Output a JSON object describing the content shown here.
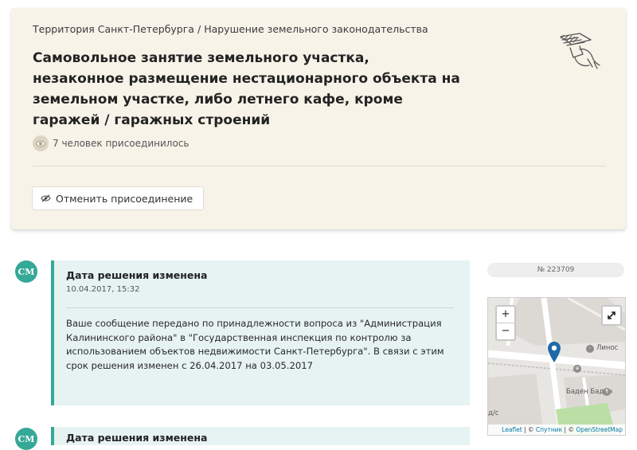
{
  "breadcrumb": {
    "region": "Территория Санкт-Петербурга",
    "separator": "/",
    "category": "Нарушение земельного законодательства"
  },
  "issue": {
    "title": "Самовольное занятие земельного участка, незаконное размещение нестационарного объекта на земельном участке, либо летнего кафе, кроме гаражей / гаражных строений",
    "joined_text": "7 человек присоединилось",
    "unjoin_label": "Отменить присоединение"
  },
  "events": [
    {
      "avatar": "СМ",
      "title": "Дата решения изменена",
      "time": "10.04.2017, 15:32",
      "body": "Ваше сообщение передано по принадлежности вопроса из \"Администрация Калининского района\" в \"Государственная инспекция по контролю за использованием объектов недвижимости Санкт-Петербурга\". В связи с этим срок решения изменен с 26.04.2017 на 03.05.2017"
    },
    {
      "avatar": "СМ",
      "title": "Дата решения изменена"
    }
  ],
  "sidebar": {
    "number": "№ 223709"
  },
  "map": {
    "zoom_in": "+",
    "zoom_out": "−",
    "labels": {
      "street": "Линос",
      "place": "Баден Баден",
      "cut": "д/с"
    },
    "attribution": {
      "leaflet": "Leaflet",
      "sep1": " | © ",
      "sputnik": "Спутник",
      "sep2": " | © ",
      "osm": "OpenStreetMap"
    }
  },
  "colors": {
    "accent": "#35a898",
    "card_bg": "#f8f3e9",
    "event_bg": "#e6f3f2",
    "pin": "#1f6aa5"
  }
}
